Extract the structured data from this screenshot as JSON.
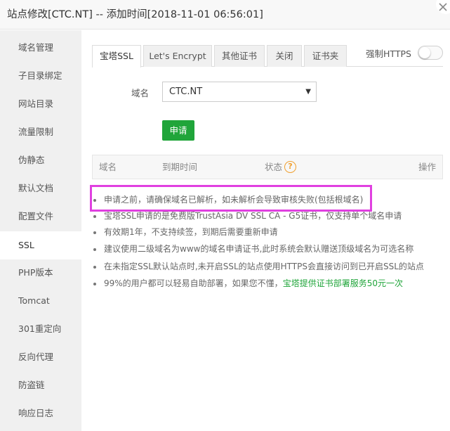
{
  "window": {
    "title": "站点修改[CTC.NT] -- 添加时间[2018-11-01 06:56:01]",
    "close_icon": "close-icon"
  },
  "sidebar": {
    "items": [
      {
        "label": "域名管理"
      },
      {
        "label": "子目录绑定"
      },
      {
        "label": "网站目录"
      },
      {
        "label": "流量限制"
      },
      {
        "label": "伪静态"
      },
      {
        "label": "默认文档"
      },
      {
        "label": "配置文件"
      },
      {
        "label": "SSL",
        "active": true
      },
      {
        "label": "PHP版本"
      },
      {
        "label": "Tomcat"
      },
      {
        "label": "301重定向"
      },
      {
        "label": "反向代理"
      },
      {
        "label": "防盗链"
      },
      {
        "label": "响应日志"
      }
    ]
  },
  "tabs": [
    {
      "label": "宝塔SSL",
      "active": true
    },
    {
      "label": "Let's Encrypt"
    },
    {
      "label": "其他证书"
    },
    {
      "label": "关闭"
    },
    {
      "label": "证书夹"
    }
  ],
  "force_https": {
    "label": "强制HTTPS",
    "enabled": false
  },
  "form": {
    "domain_label": "域名",
    "domain_value": "CTC.NT",
    "apply_label": "申请"
  },
  "table": {
    "headers": {
      "domain": "域名",
      "expire": "到期时间",
      "status": "状态",
      "action": "操作"
    },
    "help_icon": "?"
  },
  "tips": [
    {
      "text": "申请之前，请确保域名已解析，如未解析会导致审核失败(包括根域名)"
    },
    {
      "text": "宝塔SSL申请的是免费版TrustAsia DV SSL CA - G5证书，仅支持单个域名申请"
    },
    {
      "text": "有效期1年，不支持续签，到期后需要重新申请"
    },
    {
      "text": "建议使用二级域名为www的域名申请证书,此时系统会默认赠送顶级域名为可选名称"
    },
    {
      "text": "在未指定SSL默认站点时,未开启SSL的站点使用HTTPS会直接访问到已开启SSL的站点"
    },
    {
      "text": "99%的用户都可以轻易自助部署，如果您不懂，",
      "link": "宝塔提供证书部署服务50元一次"
    }
  ],
  "colors": {
    "accent_green": "#20a53a",
    "highlight_magenta": "#e040e0",
    "help_orange": "#f0a030"
  }
}
